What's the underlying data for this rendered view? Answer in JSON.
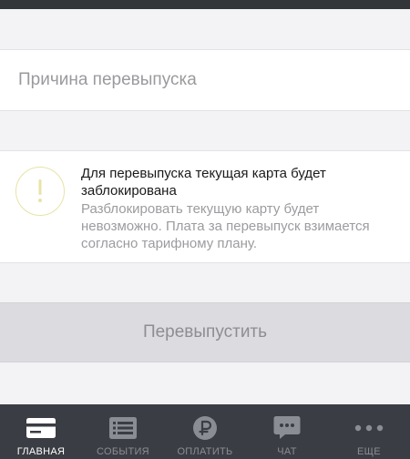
{
  "form": {
    "reason_placeholder": "Причина перевыпуска",
    "reason_value": ""
  },
  "warning": {
    "icon": "exclamation-circle-icon",
    "title": "Для перевыпуска текущая карта будет заблокирована",
    "description": "Разблокировать текущую карту будет невозможно. Плата за перевыпуск взимается согласно тарифному плану."
  },
  "actions": {
    "reissue_label": "Перевыпустить"
  },
  "tabbar": {
    "active_color": "#ffffff",
    "inactive_color": "#8a8d93",
    "items": [
      {
        "label": "ГЛАВНАЯ",
        "icon": "card-icon",
        "active": true
      },
      {
        "label": "СОБЫТИЯ",
        "icon": "list-icon",
        "active": false
      },
      {
        "label": "ОПЛАТИТЬ",
        "icon": "ruble-icon",
        "active": false
      },
      {
        "label": "ЧАТ",
        "icon": "chat-icon",
        "active": false
      },
      {
        "label": "ЕЩЕ",
        "icon": "more-icon",
        "active": false
      }
    ]
  }
}
